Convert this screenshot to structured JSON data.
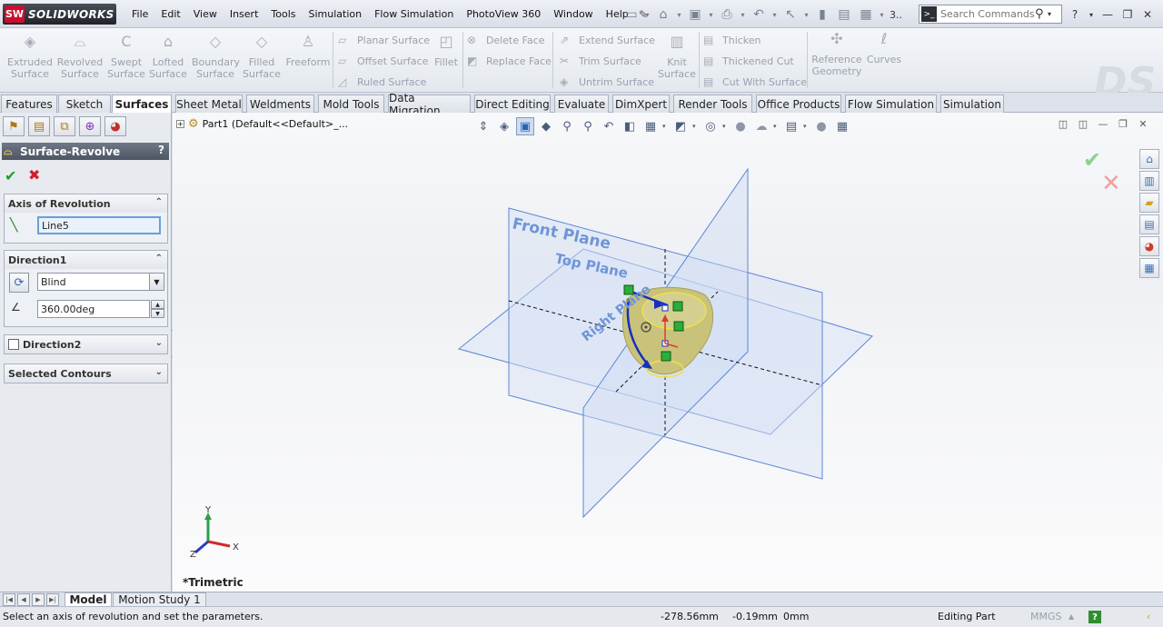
{
  "app": {
    "logo_ds": "SW",
    "logo_text": "SOLIDWORKS"
  },
  "menu": [
    "File",
    "Edit",
    "View",
    "Insert",
    "Tools",
    "Simulation",
    "Flow Simulation",
    "PhotoView 360",
    "Window",
    "Help"
  ],
  "quick_access": {
    "more": "3.."
  },
  "search": {
    "placeholder": "Search Commands"
  },
  "ribbon": {
    "big": [
      {
        "l1": "Extruded",
        "l2": "Surface"
      },
      {
        "l1": "Revolved",
        "l2": "Surface"
      },
      {
        "l1": "Swept",
        "l2": "Surface"
      },
      {
        "l1": "Lofted",
        "l2": "Surface"
      },
      {
        "l1": "Boundary",
        "l2": "Surface"
      },
      {
        "l1": "Filled",
        "l2": "Surface"
      },
      {
        "l1": "Freeform",
        "l2": ""
      },
      {
        "l1": "Fillet",
        "l2": ""
      },
      {
        "l1": "Knit",
        "l2": "Surface"
      },
      {
        "l1": "Reference",
        "l2": "Geometry"
      },
      {
        "l1": "Curves",
        "l2": ""
      }
    ],
    "small": {
      "planar": "Planar Surface",
      "offset": "Offset Surface",
      "ruled": "Ruled Surface",
      "delete_face": "Delete Face",
      "replace_face": "Replace Face",
      "extend": "Extend Surface",
      "trim": "Trim Surface",
      "untrim": "Untrim Surface",
      "thicken": "Thicken",
      "thickened_cut": "Thickened Cut",
      "cut_with_surface": "Cut With Surface"
    }
  },
  "tabs": [
    "Features",
    "Sketch",
    "Surfaces",
    "Sheet Metal",
    "Weldments",
    "Mold Tools",
    "Data Migration",
    "Direct Editing",
    "Evaluate",
    "DimXpert",
    "Render Tools",
    "Office Products",
    "Flow Simulation",
    "Simulation"
  ],
  "property_manager": {
    "title": "Surface-Revolve",
    "help": "?",
    "axis_group": "Axis of Revolution",
    "axis_value": "Line5",
    "direction1_group": "Direction1",
    "end_condition": "Blind",
    "angle": "360.00deg",
    "direction2_group": "Direction2",
    "contours_group": "Selected Contours"
  },
  "tree": {
    "label": "Part1  (Default<<Default>_..."
  },
  "viewport": {
    "view_name": "*Trimetric",
    "planes": {
      "front": "Front Plane",
      "top": "Top Plane",
      "right": "Right Plane"
    },
    "triad": {
      "x": "X",
      "y": "Y",
      "z": "Z"
    }
  },
  "bottom_tabs": [
    "Model",
    "Motion Study 1"
  ],
  "status": {
    "message": "Select an axis of revolution and set the parameters.",
    "x": "-278.56mm",
    "y": "-0.19mm",
    "z": "0mm",
    "mode": "Editing Part",
    "units": "MMGS",
    "help": "?"
  },
  "colors": {
    "plane": "#5b86d6",
    "sketch": "#1530c0",
    "surface": "#c9c27a",
    "accent": "#c8102e"
  }
}
